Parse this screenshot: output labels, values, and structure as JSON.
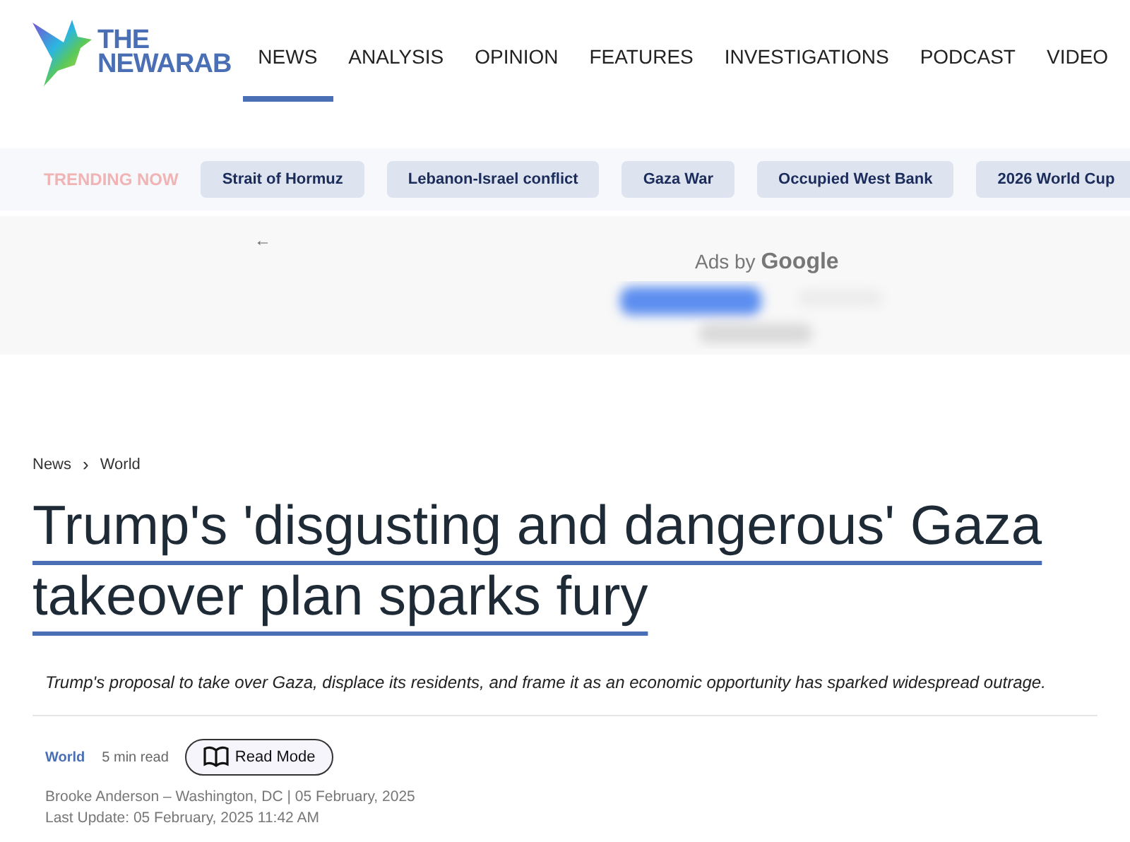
{
  "logo": {
    "lines": [
      "THE",
      "NEWARAB"
    ]
  },
  "nav": [
    {
      "label": "NEWS",
      "selected": true
    },
    {
      "label": "ANALYSIS",
      "selected": false
    },
    {
      "label": "OPINION",
      "selected": false
    },
    {
      "label": "FEATURES",
      "selected": false
    },
    {
      "label": "INVESTIGATIONS",
      "selected": false
    },
    {
      "label": "PODCAST",
      "selected": false
    },
    {
      "label": "VIDEO",
      "selected": false
    }
  ],
  "trending": {
    "label": "TRENDING NOW",
    "topics": [
      "Strait of Hormuz",
      "Lebanon-Israel conflict",
      "Gaza War",
      "Occupied West Bank",
      "2026 World Cup"
    ]
  },
  "ad": {
    "back": "←",
    "label_prefix": "Ads by",
    "label_brand": "Google"
  },
  "breadcrumb": [
    "News",
    "World"
  ],
  "breadcrumb_separator": "›",
  "headline": "Trump's 'disgusting and dangerous' Gaza takeover plan sparks fury",
  "summary": "Trump's proposal to take over Gaza, displace its residents, and frame it as an economic opportunity has sparked widespread outrage.",
  "meta": {
    "category": "World",
    "read_time": "5 min read",
    "read_mode": "Read Mode"
  },
  "byline": "Brooke Anderson – Washington, DC | 05 February, 2025",
  "last_update": "Last Update:  05 February, 2025 11:42 AM"
}
